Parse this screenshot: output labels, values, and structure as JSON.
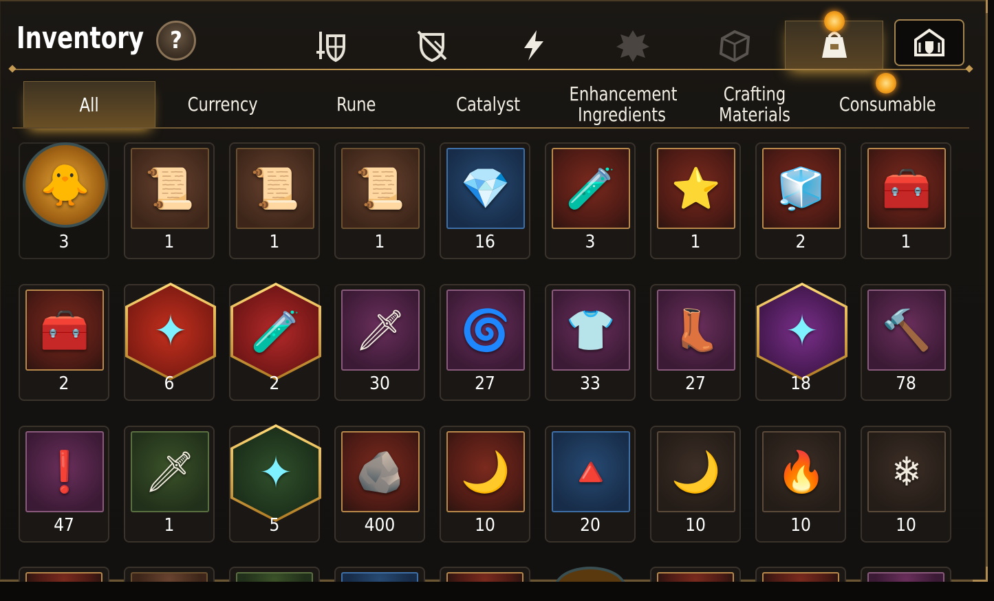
{
  "header": {
    "title": "Inventory",
    "help_symbol": "?",
    "category_icons": [
      {
        "name": "equipment-icon"
      },
      {
        "name": "no-equip-icon"
      },
      {
        "name": "artifact-lightning-icon"
      },
      {
        "name": "exclusive-icon"
      },
      {
        "name": "material-box-icon"
      },
      {
        "name": "bag-icon",
        "active": true
      },
      {
        "name": "guild-storage-icon"
      }
    ]
  },
  "tabs": [
    {
      "label": "All",
      "active": true
    },
    {
      "label": "Currency"
    },
    {
      "label": "Rune"
    },
    {
      "label": "Catalyst"
    },
    {
      "label": "Enhancement Ingredients"
    },
    {
      "label": "Crafting Materials"
    },
    {
      "label": "Consumable"
    }
  ],
  "items": [
    {
      "name": "mascot-coin",
      "count": "3",
      "icon": "🐥",
      "bg": "circle"
    },
    {
      "name": "scroll-upgrade-orange",
      "count": "1",
      "icon": "📜",
      "bg": "brown"
    },
    {
      "name": "scroll-upgrade-rainbow",
      "count": "1",
      "icon": "📜",
      "bg": "brown"
    },
    {
      "name": "scroll-upgrade-plain",
      "count": "1",
      "icon": "📜",
      "bg": "brown"
    },
    {
      "name": "gold-crystal-cluster",
      "count": "16",
      "icon": "💎",
      "bg": "blue"
    },
    {
      "name": "red-potion",
      "count": "3",
      "icon": "🧪",
      "bg": "red"
    },
    {
      "name": "star-potion",
      "count": "1",
      "icon": "⭐",
      "bg": "red"
    },
    {
      "name": "blue-chest",
      "count": "2",
      "icon": "🧊",
      "bg": "red"
    },
    {
      "name": "golden-chest",
      "count": "1",
      "icon": "🧰",
      "bg": "red"
    },
    {
      "name": "golden-chest-2",
      "count": "2",
      "icon": "🧰",
      "bg": "red"
    },
    {
      "name": "red-gem-hex",
      "count": "6",
      "icon": "✦",
      "bg": "hex-red"
    },
    {
      "name": "pink-flask-hex",
      "count": "2",
      "icon": "🧪",
      "bg": "hex-pink"
    },
    {
      "name": "sword-stone",
      "count": "30",
      "icon": "🗡",
      "bg": "purple"
    },
    {
      "name": "helm-stone",
      "count": "27",
      "icon": "🌀",
      "bg": "purple"
    },
    {
      "name": "armor-stone",
      "count": "33",
      "icon": "👕",
      "bg": "purple"
    },
    {
      "name": "boot-stone",
      "count": "27",
      "icon": "👢",
      "bg": "purple"
    },
    {
      "name": "star-stone-hex",
      "count": "18",
      "icon": "✦",
      "bg": "hex-purple"
    },
    {
      "name": "hammer-stone",
      "count": "78",
      "icon": "🔨",
      "bg": "purple"
    },
    {
      "name": "exclaim-stone",
      "count": "47",
      "icon": "❗",
      "bg": "purple"
    },
    {
      "name": "sword-stone-white",
      "count": "1",
      "icon": "🗡",
      "bg": "green"
    },
    {
      "name": "star-stone-white-hex",
      "count": "5",
      "icon": "✦",
      "bg": "hex-green"
    },
    {
      "name": "dark-crystal-shard",
      "count": "400",
      "icon": "🪨",
      "bg": "red"
    },
    {
      "name": "moon-pentagon-gem",
      "count": "10",
      "icon": "🌙",
      "bg": "red"
    },
    {
      "name": "moon-triangle-gem",
      "count": "20",
      "icon": "🔺",
      "bg": "blue"
    },
    {
      "name": "pink-disc",
      "count": "10",
      "icon": "🌙",
      "bg": "dark"
    },
    {
      "name": "red-disc",
      "count": "10",
      "icon": "🔥",
      "bg": "dark"
    },
    {
      "name": "blue-disc",
      "count": "10",
      "icon": "❄",
      "bg": "dark"
    }
  ]
}
